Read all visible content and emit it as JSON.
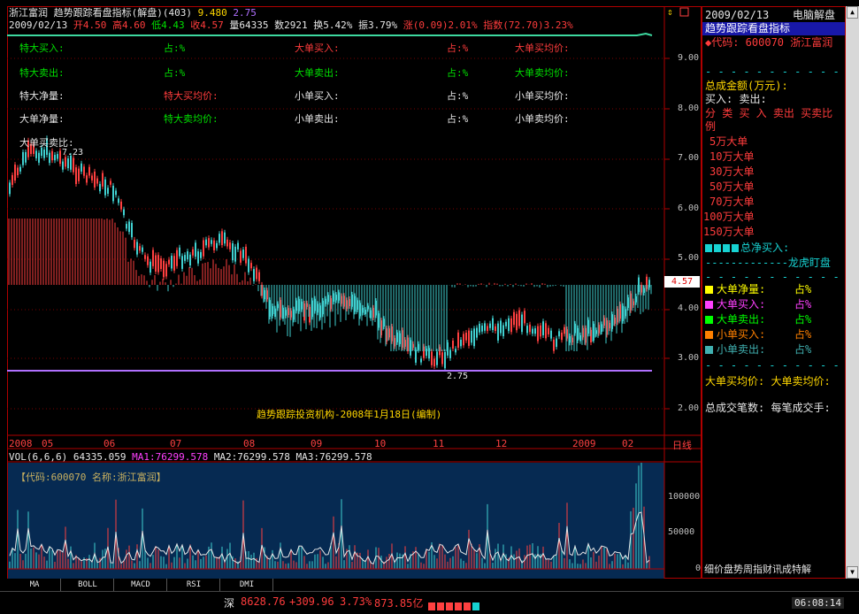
{
  "header": {
    "stock_name": "浙江富润",
    "indicator": "趋势跟踪看盘指标(解盘)(403)",
    "ind_v1": "9.480",
    "ind_v2": "2.75",
    "date": "2009/02/13",
    "open": "开4.50",
    "high": "高4.60",
    "low": "低4.43",
    "close": "收4.57",
    "vol": "量64335",
    "amount": "数2921",
    "turnover": "换5.42%",
    "amplitude": "振3.79%",
    "change": "涨(0.09)2.01%",
    "index": "指数(72.70)3.23%"
  },
  "panel_rows": [
    [
      {
        "text": "特大买入:",
        "color": "grn"
      },
      {
        "text": "占:%",
        "color": "grn"
      },
      {
        "text": "大单买入:",
        "color": "red"
      },
      {
        "text": "占:%",
        "color": "red"
      },
      {
        "text": "大单买均价:",
        "color": "red"
      }
    ],
    [
      {
        "text": "特大卖出:",
        "color": "grn"
      },
      {
        "text": "占:%",
        "color": "grn"
      },
      {
        "text": "大单卖出:",
        "color": "grn"
      },
      {
        "text": "占:%",
        "color": "grn"
      },
      {
        "text": "大单卖均价:",
        "color": "grn"
      }
    ],
    [
      {
        "text": "特大净量:",
        "color": "wht"
      },
      {
        "text": "特大买均价:",
        "color": "red"
      },
      {
        "text": "小单买入:",
        "color": "wht"
      },
      {
        "text": "占:%",
        "color": "wht"
      },
      {
        "text": "小单买均价:",
        "color": "wht"
      }
    ],
    [
      {
        "text": "大单净量:",
        "color": "wht"
      },
      {
        "text": "特大卖均价:",
        "color": "grn"
      },
      {
        "text": "小单卖出:",
        "color": "wht"
      },
      {
        "text": "占:%",
        "color": "wht"
      },
      {
        "text": "小单卖均价:",
        "color": "wht"
      }
    ]
  ],
  "ratio_label": "大单买卖比:",
  "high_label": "7.23",
  "low_label": "2.75",
  "footer_note": "趋势跟踪投资机构-2008年1月18日(编制)",
  "price_axis": [
    "9.00",
    "8.00",
    "7.00",
    "6.00",
    "5.00",
    "4.00",
    "3.00",
    "2.00"
  ],
  "current_price": "4.57",
  "time_axis": [
    "2008",
    "05",
    "06",
    "07",
    "08",
    "09",
    "10",
    "11",
    "12",
    "2009",
    "02"
  ],
  "period_label": "日线",
  "vol_header": {
    "vol": "VOL(6,6,6)",
    "vol_val": "64335.059",
    "ma1": "MA1:76299.578",
    "ma2": "MA2:76299.578",
    "ma3": "MA3:76299.578"
  },
  "vol_code_label": "【代码:600070 名称:浙江富润】",
  "vol_axis": [
    "100000",
    "50000",
    "0"
  ],
  "tabs": [
    "MA",
    "BOLL",
    "MACD",
    "RSI",
    "DMI"
  ],
  "right_panel": {
    "date": "2009/02/13",
    "title": "电脑解盘",
    "subtitle": "趋势跟踪看盘指标",
    "code_line": "◆代码: 600070 浙江富润",
    "total_amount": "总成金额(万元):",
    "buy_sell": "买入:  卖出:",
    "cols": "分  类 买  入  卖出  买卖比例",
    "tiers": [
      "5万大单",
      "10万大单",
      "30万大单",
      "50万大单",
      "70万大单",
      "100万大单",
      "150万大单"
    ],
    "net_buy": "总净买入:",
    "dragon": "-------------龙虎盯盘",
    "legend": [
      {
        "label": "大单净量:",
        "pct": "占%",
        "color": "#ffff00",
        "tcolor": "#ffff00"
      },
      {
        "label": "大单买入:",
        "pct": "占%",
        "color": "#ff40ff",
        "tcolor": "#ff40ff"
      },
      {
        "label": "大单卖出:",
        "pct": "占%",
        "color": "#00ff00",
        "tcolor": "#00ff00"
      },
      {
        "label": "小单买入:",
        "pct": "占%",
        "color": "#ff8000",
        "tcolor": "#ff8000"
      },
      {
        "label": "小单卖出:",
        "pct": "占%",
        "color": "#40b0b0",
        "tcolor": "#40b0b0"
      }
    ],
    "avg_price": "大单买均价:   大单卖均价:",
    "total_trades": "总成交笔数:   每笔成交手:",
    "bottom_tabs": "细价盘势周指财讯成特解"
  },
  "status": {
    "market": "深",
    "index": "8628.76",
    "change": "+309.96",
    "pct": "3.73%",
    "amount": "873.85亿",
    "time": "06:08:14"
  }
}
